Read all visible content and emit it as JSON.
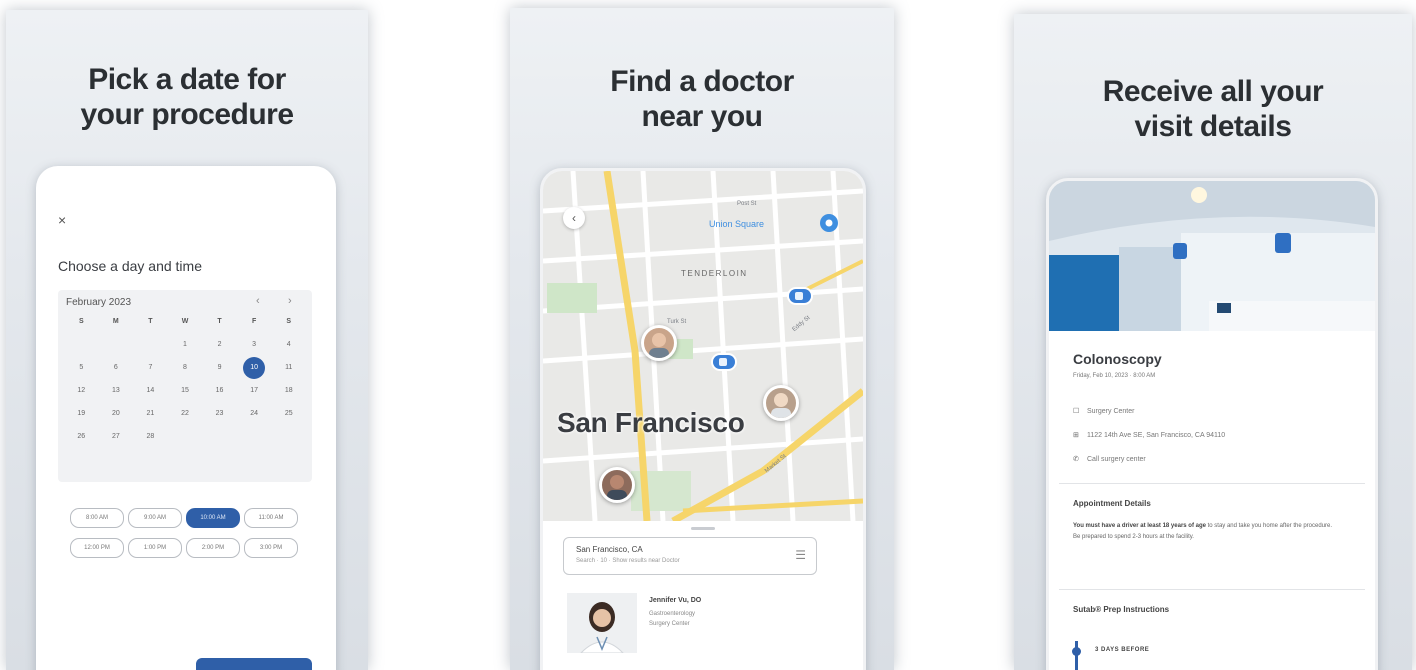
{
  "colors": {
    "accent": "#2f5fa8",
    "map_road": "#f6d56a",
    "map_park": "#cfe6c8",
    "map_bg": "#e9e9e7"
  },
  "panels": [
    {
      "headline": [
        "Pick a date for",
        "your procedure"
      ],
      "screen": {
        "back_icon": "×",
        "title": "Choose a day and time",
        "calendar": {
          "month": "February 2023",
          "prev_icon": "‹",
          "next_icon": "›",
          "weekdays": [
            "S",
            "M",
            "T",
            "W",
            "T",
            "F",
            "S"
          ],
          "days": [
            "",
            "",
            "",
            "1",
            "2",
            "3",
            "4",
            "5",
            "6",
            "7",
            "8",
            "9",
            "10",
            "11",
            "12",
            "13",
            "14",
            "15",
            "16",
            "17",
            "18",
            "19",
            "20",
            "21",
            "22",
            "23",
            "24",
            "25",
            "26",
            "27",
            "28",
            "",
            "",
            "",
            ""
          ],
          "selected_day": "10"
        },
        "time_slots": [
          "8:00 AM",
          "9:00 AM",
          "10:00 AM",
          "11:00 AM",
          "12:00 PM",
          "1:00 PM",
          "2:00 PM",
          "3:00 PM"
        ],
        "selected_slot": "10:00 AM"
      }
    },
    {
      "headline": [
        "Find a doctor",
        "near you"
      ],
      "screen": {
        "back_icon": "‹",
        "city": "San Francisco",
        "poi": "Union Square",
        "neighborhood": "TENDERLOIN",
        "streets": [
          "Post St",
          "Turk St",
          "Eddy St",
          "Market St"
        ],
        "search_location": "San Francisco, CA",
        "search_sub": "Search · 10 · Show results near Doctor",
        "filter_icon": "☰",
        "doctor": {
          "name": "Jennifer Vu, DO",
          "specialty": "Gastroenterology",
          "location": "Surgery Center"
        }
      }
    },
    {
      "headline": [
        "Receive all your",
        "visit details"
      ],
      "screen": {
        "procedure": "Colonoscopy",
        "datetime": "Friday, Feb 10, 2023 · 8:00 AM",
        "rows": [
          {
            "icon": "☐",
            "text": "Surgery Center"
          },
          {
            "icon": "⊞",
            "text": "1122 14th Ave SE, San Francisco, CA 94110"
          },
          {
            "icon": "✆",
            "text": "Call surgery center"
          }
        ],
        "appointment_heading": "Appointment Details",
        "appointment_lead": "You must have a driver at least 18 years of age",
        "appointment_body": " to stay and take you home after the procedure. Be prepared to spend 2-3 hours at the facility.",
        "prep_heading": "Sutab® Prep Instructions",
        "prep_step": "3 DAYS BEFORE"
      }
    }
  ]
}
